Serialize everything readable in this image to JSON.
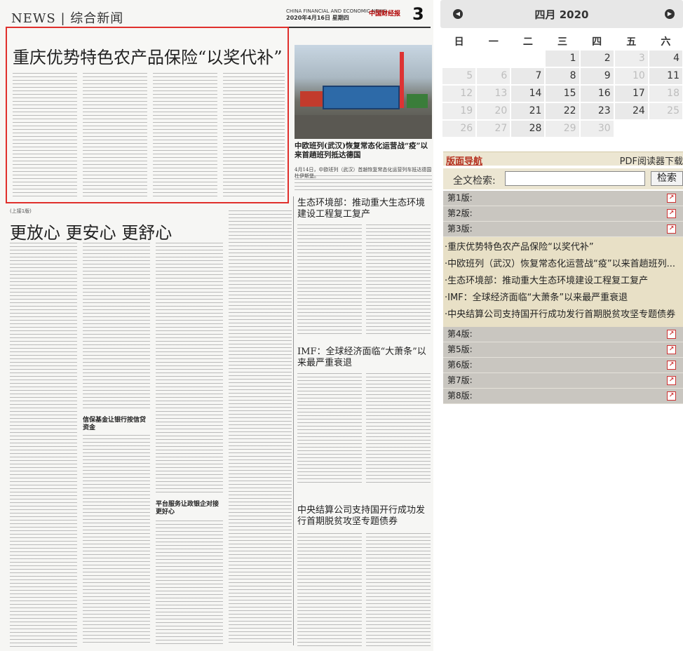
{
  "paper": {
    "section_name": "NEWS | 综合新闻",
    "meta_line1": "CHINA FINANCIAL AND ECONOMIC NEWS",
    "meta_line2": "2020年4月16日 星期四",
    "logo": "中国财经报",
    "page_number": "3",
    "story1_headline": "重庆优势特色农产品保险“以奖代补”",
    "photo_caption_title": "中欧班列(武汉)恢复常态化运营战“疫”以来首趟班列抵达德国",
    "photo_caption_body": "4月14日，中欧班列（武汉）首趟恢复常态化运营列车抵达德国杜伊斯堡。",
    "story2_tag": "(上接1版)",
    "story2_headline": "更放心 更安心 更舒心",
    "story3_headline": "生态环境部：推动重大生态环境建设工程复工复产",
    "story4_headline": "IMF：全球经济面临“大萧条”以来最严重衰退",
    "story5_headline": "中央结算公司支持国开行成功发行首期脱贫攻坚专题债券",
    "mid_subhead1": "信保基金让银行按信贷资金",
    "mid_subhead2": "平台服务让政银企对接更好心"
  },
  "calendar": {
    "title": "四月 2020",
    "prev_icon": "left-arrow-icon",
    "next_icon": "right-arrow-icon",
    "weekdays": [
      "日",
      "一",
      "二",
      "三",
      "四",
      "五",
      "六"
    ],
    "weeks": [
      [
        {
          "d": "",
          "m": false,
          "b": true
        },
        {
          "d": "",
          "m": false,
          "b": true
        },
        {
          "d": "",
          "m": false,
          "b": true
        },
        {
          "d": "1",
          "m": false
        },
        {
          "d": "2",
          "m": false
        },
        {
          "d": "3",
          "m": true
        },
        {
          "d": "4",
          "m": false
        }
      ],
      [
        {
          "d": "5",
          "m": true
        },
        {
          "d": "6",
          "m": true
        },
        {
          "d": "7",
          "m": false
        },
        {
          "d": "8",
          "m": false
        },
        {
          "d": "9",
          "m": false
        },
        {
          "d": "10",
          "m": true
        },
        {
          "d": "11",
          "m": false
        }
      ],
      [
        {
          "d": "12",
          "m": true
        },
        {
          "d": "13",
          "m": true
        },
        {
          "d": "14",
          "m": false
        },
        {
          "d": "15",
          "m": false
        },
        {
          "d": "16",
          "m": false
        },
        {
          "d": "17",
          "m": false
        },
        {
          "d": "18",
          "m": true
        }
      ],
      [
        {
          "d": "19",
          "m": true
        },
        {
          "d": "20",
          "m": true
        },
        {
          "d": "21",
          "m": false
        },
        {
          "d": "22",
          "m": false
        },
        {
          "d": "23",
          "m": false
        },
        {
          "d": "24",
          "m": false
        },
        {
          "d": "25",
          "m": true
        }
      ],
      [
        {
          "d": "26",
          "m": true
        },
        {
          "d": "27",
          "m": true
        },
        {
          "d": "28",
          "m": false
        },
        {
          "d": "29",
          "m": true
        },
        {
          "d": "30",
          "m": true
        },
        {
          "d": "",
          "m": false,
          "b": true
        },
        {
          "d": "",
          "m": false,
          "b": true
        }
      ]
    ]
  },
  "nav": {
    "label": "版面导航",
    "pdf_label": "PDF阅读器下载"
  },
  "search": {
    "label": "全文检索:",
    "placeholder": "",
    "button_label": "检索"
  },
  "pages_before": [
    {
      "label": "第1版:"
    },
    {
      "label": "第2版:"
    },
    {
      "label": "第3版:"
    }
  ],
  "articles": [
    {
      "title": "·重庆优势特色农产品保险“以奖代补”"
    },
    {
      "title": "·中欧班列（武汉）恢复常态化运营战“疫”以来首趟班列..."
    },
    {
      "title": "·生态环境部：推动重大生态环境建设工程复工复产"
    },
    {
      "title": "·IMF：全球经济面临“大萧条”以来最严重衰退"
    },
    {
      "title": "·中央结算公司支持国开行成功发行首期脱贫攻坚专题债券"
    }
  ],
  "pages_after": [
    {
      "label": "第4版:"
    },
    {
      "label": "第5版:"
    },
    {
      "label": "第6版:"
    },
    {
      "label": "第7版:"
    },
    {
      "label": "第8版:"
    }
  ],
  "colors": {
    "highlight_border": "#e0302c",
    "nav_text": "#b5301f"
  }
}
